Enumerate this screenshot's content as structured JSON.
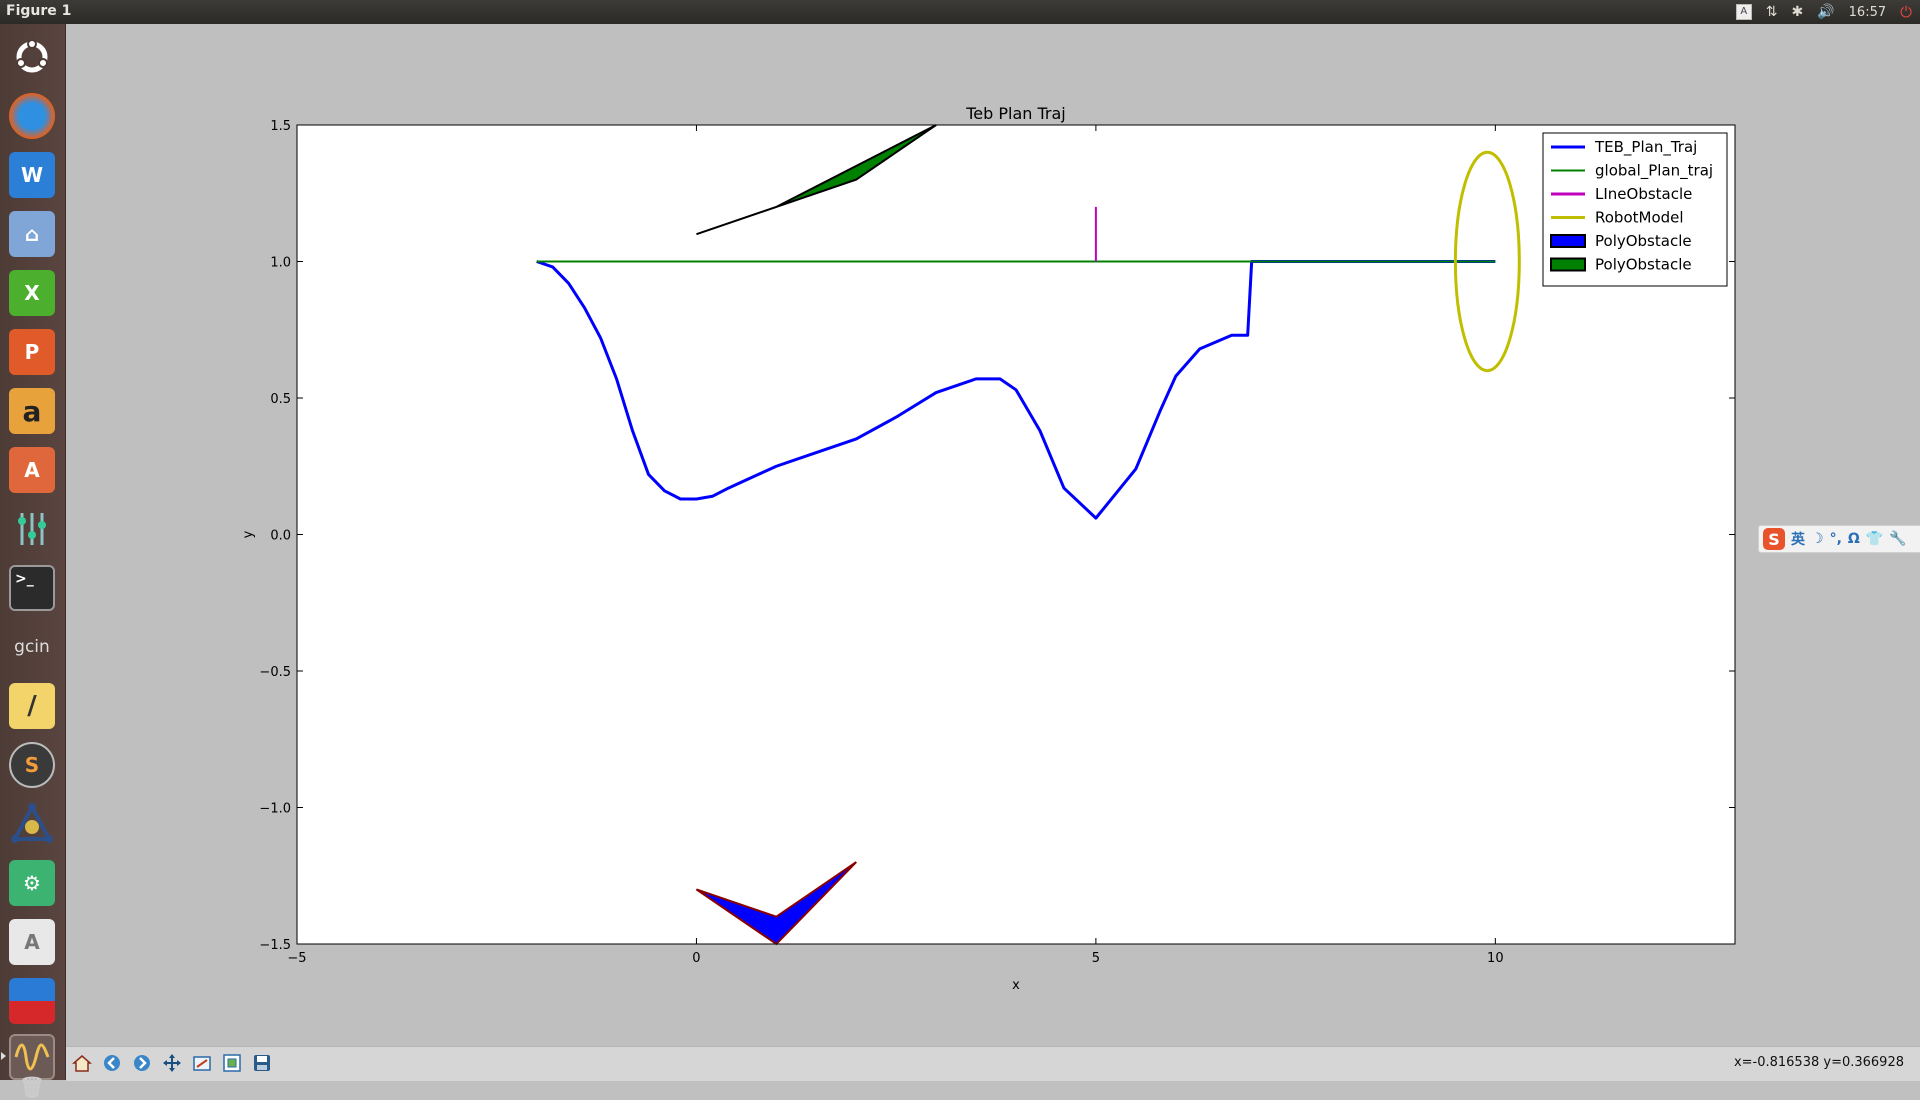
{
  "window": {
    "title": "Figure 1"
  },
  "tray": {
    "keyboard_label": "A",
    "network_icon": "network-arrows-icon",
    "bluetooth_icon": "bluetooth-icon",
    "volume_icon": "volume-icon",
    "clock": "16:57",
    "power_icon": "power-icon"
  },
  "launcher": {
    "items": [
      {
        "name": "ubuntu-dash-icon"
      },
      {
        "name": "firefox-icon"
      },
      {
        "name": "wps-writer-icon",
        "label": "W"
      },
      {
        "name": "files-icon"
      },
      {
        "name": "wps-spreadsheet-icon",
        "label": "X"
      },
      {
        "name": "wps-presentation-icon",
        "label": "P"
      },
      {
        "name": "amazon-icon",
        "label": "a"
      },
      {
        "name": "software-center-icon",
        "label": "A"
      },
      {
        "name": "system-settings-icon"
      },
      {
        "name": "terminal-icon",
        "label": ">_"
      },
      {
        "name": "gcin-icon",
        "label": "gcin"
      },
      {
        "name": "text-editor-icon",
        "label": "/"
      },
      {
        "name": "sublime-icon",
        "label": "S"
      },
      {
        "name": "robot-icon"
      },
      {
        "name": "qt-icon"
      },
      {
        "name": "font-viewer-icon",
        "label": "A"
      },
      {
        "name": "vscode-icon"
      },
      {
        "name": "matplotlib-figure-icon"
      },
      {
        "name": "trash-icon"
      }
    ]
  },
  "toolbar": {
    "buttons": [
      "home-icon",
      "back-icon",
      "forward-icon",
      "pan-icon",
      "zoom-icon",
      "subplots-icon",
      "save-icon"
    ],
    "coords": "x=-0.816538     y=0.366928"
  },
  "ime": {
    "logo": "S",
    "items": [
      "英",
      "☽",
      "°,",
      "Ω",
      "👕",
      "🔧"
    ]
  },
  "chart_data": {
    "type": "line",
    "title": "Teb Plan Traj",
    "xlabel": "x",
    "ylabel": "y",
    "xlim": [
      -5,
      13
    ],
    "ylim": [
      -1.5,
      1.5
    ],
    "xticks": [
      -5,
      0,
      5,
      10
    ],
    "xtick_labels": [
      "−5",
      "0",
      "5",
      "10"
    ],
    "yticks": [
      1.5,
      1.0,
      0.5,
      0.0,
      -0.5,
      -1.0,
      -1.5
    ],
    "ytick_labels": [
      "1.5",
      "1.0",
      "0.5",
      "0.0",
      "−0.5",
      "−1.0",
      "−1.5"
    ],
    "grid": false,
    "legend_position": "top-right",
    "series": [
      {
        "name": "TEB_Plan_Traj",
        "kind": "line",
        "color": "#0000ff",
        "x": [
          -2.0,
          -1.8,
          -1.6,
          -1.4,
          -1.2,
          -1.0,
          -0.8,
          -0.6,
          -0.4,
          -0.2,
          0.0,
          0.2,
          0.4,
          0.7,
          1.0,
          1.5,
          2.0,
          2.5,
          3.0,
          3.5,
          3.8,
          4.0,
          4.3,
          4.6,
          5.0,
          5.5,
          5.8,
          6.0,
          6.3,
          6.7,
          6.9,
          6.95,
          7.5,
          8.5,
          9.5,
          10.0
        ],
        "y": [
          1.0,
          0.98,
          0.92,
          0.83,
          0.72,
          0.57,
          0.38,
          0.22,
          0.16,
          0.13,
          0.13,
          0.14,
          0.17,
          0.21,
          0.25,
          0.3,
          0.35,
          0.43,
          0.52,
          0.57,
          0.57,
          0.53,
          0.38,
          0.17,
          0.06,
          0.24,
          0.45,
          0.58,
          0.68,
          0.73,
          0.73,
          1.0,
          1.0,
          1.0,
          1.0,
          1.0
        ]
      },
      {
        "name": "global_Plan_traj",
        "kind": "line",
        "color": "#008000",
        "x": [
          -2.0,
          10.0
        ],
        "y": [
          1.0,
          1.0
        ]
      },
      {
        "name": "LIneObstacle",
        "kind": "line",
        "color": "#bf00bf",
        "x": [
          5.0,
          5.0
        ],
        "y": [
          1.0,
          1.2
        ]
      },
      {
        "name": "RobotModel",
        "kind": "ellipse",
        "color": "#bfbf00",
        "center": [
          9.9,
          1.0
        ],
        "width": 0.8,
        "height": 0.8
      },
      {
        "name": "PolyObstacle",
        "kind": "polygon",
        "fill": "#0000ff",
        "edge": "#8b0000",
        "x": [
          0.0,
          1.0,
          2.0,
          1.0
        ],
        "y": [
          -1.3,
          -1.4,
          -1.2,
          -1.5
        ]
      },
      {
        "name": "PolyObstacle",
        "kind": "polygon",
        "fill": "#008000",
        "edge": "#000000",
        "x": [
          0.0,
          2.0,
          3.0,
          1.0
        ],
        "y": [
          1.1,
          1.3,
          1.5,
          1.2
        ]
      }
    ]
  }
}
